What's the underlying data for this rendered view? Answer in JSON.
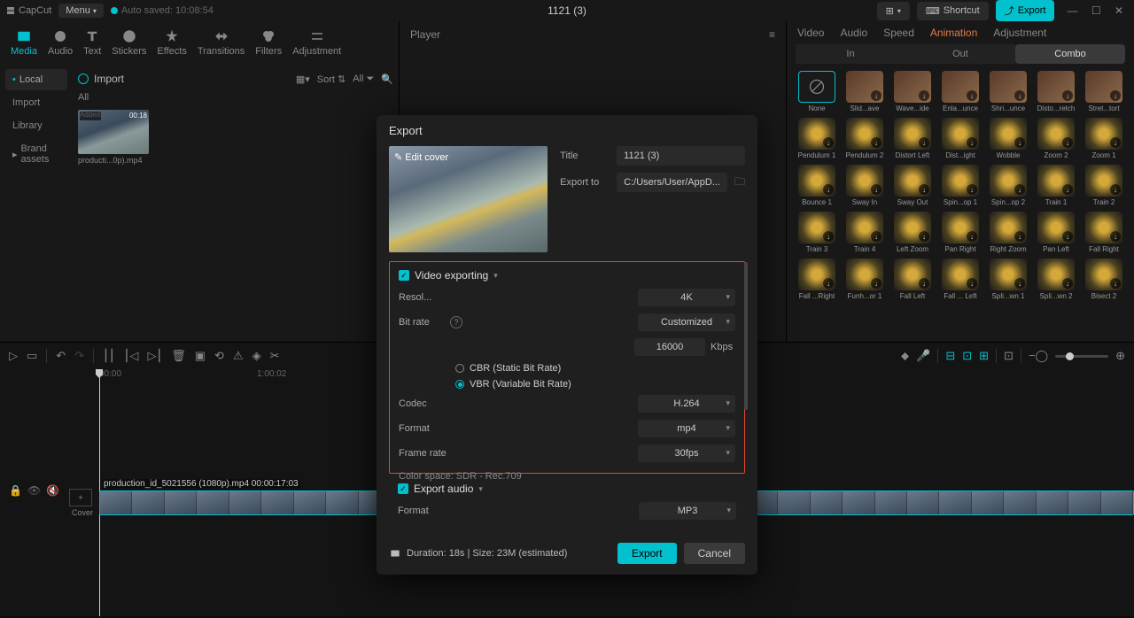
{
  "titlebar": {
    "app": "CapCut",
    "menu": "Menu",
    "autosave": "Auto saved: 10:08:54",
    "title": "1121 (3)",
    "layout_icon": "⊞",
    "shortcut": "Shortcut",
    "export": "Export"
  },
  "tool_tabs": [
    "Media",
    "Audio",
    "Text",
    "Stickers",
    "Effects",
    "Transitions",
    "Filters",
    "Adjustment"
  ],
  "left_sidebar": {
    "items": [
      {
        "label": "Local",
        "active": true,
        "class": "local"
      },
      {
        "label": "Import",
        "active": false
      },
      {
        "label": "Library",
        "active": false
      },
      {
        "label": "Brand assets",
        "active": false,
        "prefix": "▸ "
      }
    ]
  },
  "media": {
    "import": "Import",
    "sort": "Sort",
    "all": "All",
    "filter_all": "All",
    "thumb_badge": "Added",
    "thumb_dur": "00:18",
    "clip_name": "producti...0p).mp4"
  },
  "player": {
    "label": "Player"
  },
  "right_tabs": [
    "Video",
    "Audio",
    "Speed",
    "Animation",
    "Adjustment"
  ],
  "sub_tabs": [
    "In",
    "Out",
    "Combo"
  ],
  "anim_rows": [
    [
      "None",
      "Slid...ave",
      "Wave...ide",
      "Enla...unce",
      "Shri...unce",
      "Disto...retch",
      "Stret...tort"
    ],
    [
      "Pendulum 1",
      "Pendulum 2",
      "Distort Left",
      "Dist...ight",
      "Wobble",
      "Zoom 2",
      "Zoom 1"
    ],
    [
      "Bounce 1",
      "Sway In",
      "Sway Out",
      "Spin...op 1",
      "Spin...op 2",
      "Train 1",
      "Train 2"
    ],
    [
      "Train 3",
      "Train 4",
      "Left Zoom",
      "Pan Right",
      "Right Zoom",
      "Pan Left",
      "Fall Right"
    ],
    [
      "Fall ...Right",
      "Funh...or 1",
      "Fall Left",
      "Fall ... Left",
      "Spli...wn 1",
      "Spli...wn 2",
      "Bisect 2"
    ]
  ],
  "timeline": {
    "marks": [
      "00:00",
      "1:00:02"
    ],
    "clip_label": "production_id_5021556 (1080p).mp4  00:00:17:03",
    "cover": "Cover"
  },
  "modal": {
    "title": "Export",
    "edit_cover": "Edit cover",
    "title_label": "Title",
    "title_value": "1121 (3)",
    "exportto_label": "Export to",
    "exportto_value": "C:/Users/User/AppD...",
    "video_head": "Video exporting",
    "resolution_label": "Resol...",
    "resolution_value": "4K",
    "bitrate_label": "Bit rate",
    "bitrate_value": "Customized",
    "bitrate_num": "16000",
    "bitrate_unit": "Kbps",
    "cbr": "CBR (Static Bit Rate)",
    "vbr": "VBR (Variable Bit Rate)",
    "codec_label": "Codec",
    "codec_value": "H.264",
    "format_label": "Format",
    "format_value": "mp4",
    "framerate_label": "Frame rate",
    "framerate_value": "30fps",
    "color_space": "Color space: SDR - Rec.709",
    "audio_head": "Export audio",
    "audio_format_label": "Format",
    "audio_format_value": "MP3",
    "duration": "Duration: 18s | Size: 23M (estimated)",
    "export_btn": "Export",
    "cancel_btn": "Cancel"
  }
}
